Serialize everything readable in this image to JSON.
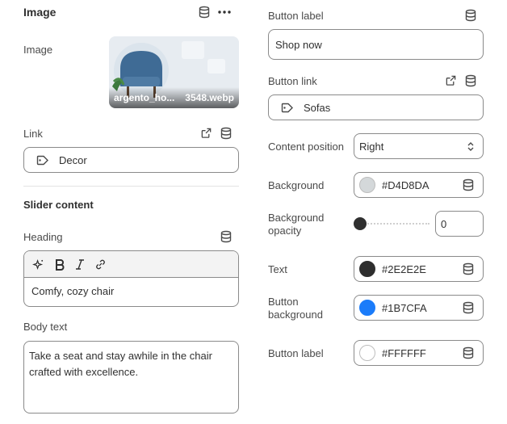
{
  "image_section": {
    "title": "Image",
    "image_label": "Image",
    "image_file_name": "argento_ho...",
    "image_file_ext": "3548.webp",
    "link_label": "Link",
    "link_value": "Decor"
  },
  "slider_content": {
    "title": "Slider content",
    "heading_label": "Heading",
    "heading_value": "Comfy, cozy chair",
    "body_label": "Body text",
    "body_value": "Take a seat and stay awhile in the chair crafted with excellence."
  },
  "button": {
    "label_label": "Button label",
    "label_value": "Shop now",
    "link_label": "Button link",
    "link_value": "Sofas"
  },
  "content_position": {
    "label": "Content position",
    "value": "Right"
  },
  "colors": {
    "background_label": "Background",
    "background_value": "#D4D8DA",
    "background_opacity_label_1": "Background",
    "background_opacity_label_2": "opacity",
    "background_opacity_value": "0",
    "text_label": "Text",
    "text_value": "#2E2E2E",
    "button_background_label_1": "Button",
    "button_background_label_2": "background",
    "button_background_value": "#1B7CFA",
    "button_label_label": "Button label",
    "button_label_value": "#FFFFFF"
  },
  "icons": [
    "database-icon",
    "more-icon",
    "external-link-icon",
    "tag-icon",
    "sparkle-icon",
    "bold-icon",
    "italic-icon",
    "link-icon",
    "chevron-updown-icon"
  ]
}
